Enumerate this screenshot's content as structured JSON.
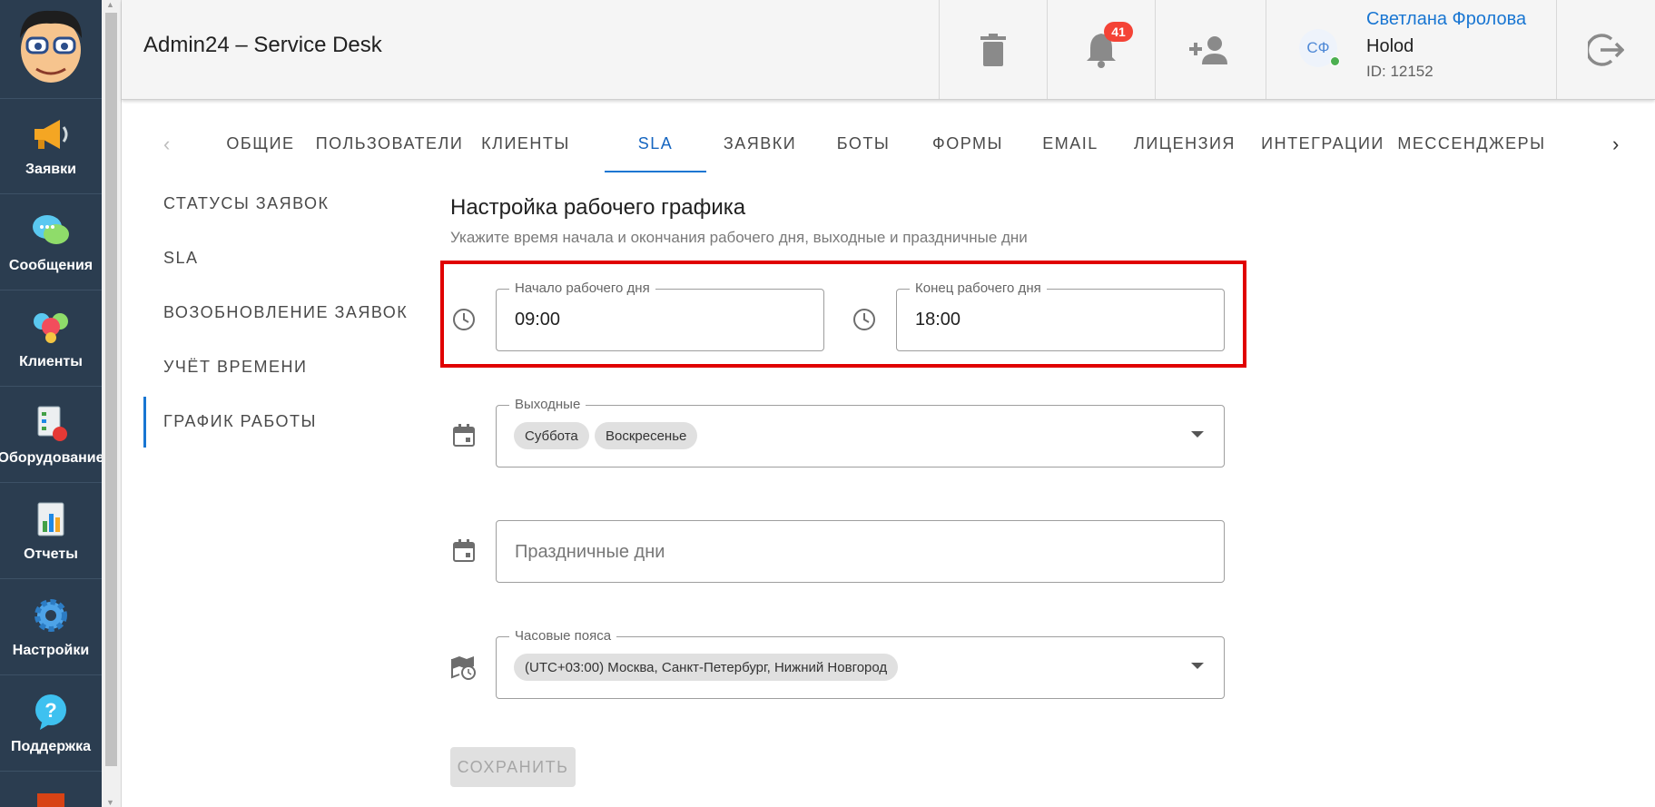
{
  "app": {
    "title": "Admin24 – Service Desk"
  },
  "rail": {
    "items": [
      {
        "label": "Заявки",
        "icon": "megaphone-icon"
      },
      {
        "label": "Сообщения",
        "icon": "chat-bubbles-icon"
      },
      {
        "label": "Клиенты",
        "icon": "clients-icon"
      },
      {
        "label": "Оборудование",
        "icon": "equipment-icon"
      },
      {
        "label": "Отчеты",
        "icon": "report-chart-icon"
      },
      {
        "label": "Настройки",
        "icon": "gear-icon"
      },
      {
        "label": "Поддержка",
        "icon": "help-icon"
      }
    ]
  },
  "header": {
    "notifications_count": "41",
    "user": {
      "initials": "СФ",
      "name": "Светлана Фролова",
      "org": "Holod",
      "id": "ID: 12152"
    }
  },
  "tabs": [
    "ОБЩИЕ",
    "ПОЛЬЗОВАТЕЛИ",
    "КЛИЕНТЫ",
    "SLA",
    "ЗАЯВКИ",
    "БОТЫ",
    "ФОРМЫ",
    "EMAIL",
    "ЛИЦЕНЗИЯ",
    "ИНТЕГРАЦИИ",
    "МЕССЕНДЖЕРЫ"
  ],
  "active_tab": "SLA",
  "subnav": [
    "СТАТУСЫ ЗАЯВОК",
    "SLA",
    "ВОЗОБНОВЛЕНИЕ ЗАЯВОК",
    "УЧЁТ ВРЕМЕНИ",
    "ГРАФИК РАБОТЫ"
  ],
  "active_subnav": "ГРАФИК РАБОТЫ",
  "form": {
    "title": "Настройка рабочего графика",
    "subtitle": "Укажите время начала и окончания рабочего дня, выходные и праздничные дни",
    "start": {
      "label": "Начало рабочего дня",
      "value": "09:00"
    },
    "end": {
      "label": "Конец рабочего дня",
      "value": "18:00"
    },
    "weekends": {
      "label": "Выходные",
      "chips": [
        "Суббота",
        "Воскресенье"
      ]
    },
    "holidays": {
      "placeholder": "Праздничные дни"
    },
    "timezone": {
      "label": "Часовые пояса",
      "chip": "(UTC+03:00) Москва, Санкт-Петербург, Нижний Новгород"
    },
    "save_label": "СОХРАНИТЬ"
  },
  "colors": {
    "rail_bg": "#2b3d50",
    "accent": "#1976d2",
    "highlight": "#e00000",
    "badge": "#f44336"
  }
}
